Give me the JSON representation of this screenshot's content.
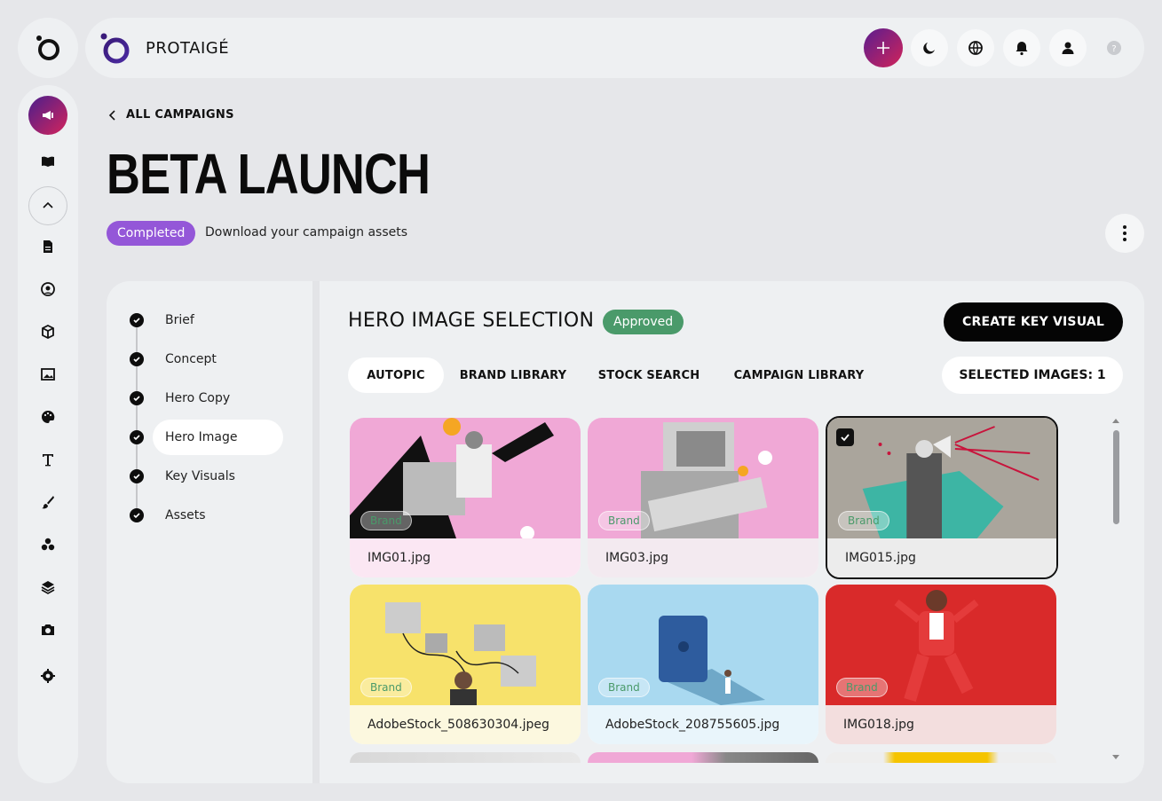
{
  "app": {
    "brand": "PROTAIGÉ"
  },
  "topbar": {
    "icons": [
      "plus-icon",
      "moon-icon",
      "globe-icon",
      "bell-icon",
      "user-icon",
      "help-icon"
    ]
  },
  "sidebar": {
    "items": [
      "campaign-icon",
      "book-icon",
      "chevron-up-icon",
      "document-icon",
      "user-circle-icon",
      "box-icon",
      "image-icon",
      "palette-icon",
      "text-icon",
      "brush-icon",
      "circles-icon",
      "layers-icon",
      "camera-icon",
      "gear-icon"
    ]
  },
  "header": {
    "back_label": "ALL CAMPAIGNS",
    "title": "BETA LAUNCH",
    "status": "Completed",
    "description": "Download your campaign assets"
  },
  "steps": [
    {
      "label": "Brief"
    },
    {
      "label": "Concept"
    },
    {
      "label": "Hero Copy"
    },
    {
      "label": "Hero Image"
    },
    {
      "label": "Key Visuals"
    },
    {
      "label": "Assets"
    }
  ],
  "section": {
    "title": "HERO IMAGE SELECTION",
    "approval": "Approved",
    "cta": "CREATE KEY VISUAL",
    "tabs": [
      "AUTOPIC",
      "BRAND LIBRARY",
      "STOCK SEARCH",
      "CAMPAIGN LIBRARY"
    ],
    "selected_count": "SELECTED IMAGES: 1"
  },
  "images": [
    {
      "name": "IMG01.jpg",
      "badge": "Brand",
      "selected": false
    },
    {
      "name": "IMG03.jpg",
      "badge": "Brand",
      "selected": false
    },
    {
      "name": "IMG015.jpg",
      "badge": "Brand",
      "selected": true
    },
    {
      "name": "AdobeStock_508630304.jpeg",
      "badge": "Brand",
      "selected": false
    },
    {
      "name": "AdobeStock_208755605.jpg",
      "badge": "Brand",
      "selected": false
    },
    {
      "name": "IMG018.jpg",
      "badge": "Brand",
      "selected": false
    }
  ],
  "colors": {
    "accent_gradient_start": "#4a1f8c",
    "accent_gradient_end": "#d4245c",
    "completed": "#9457d8",
    "approved": "#4a9a6a"
  }
}
